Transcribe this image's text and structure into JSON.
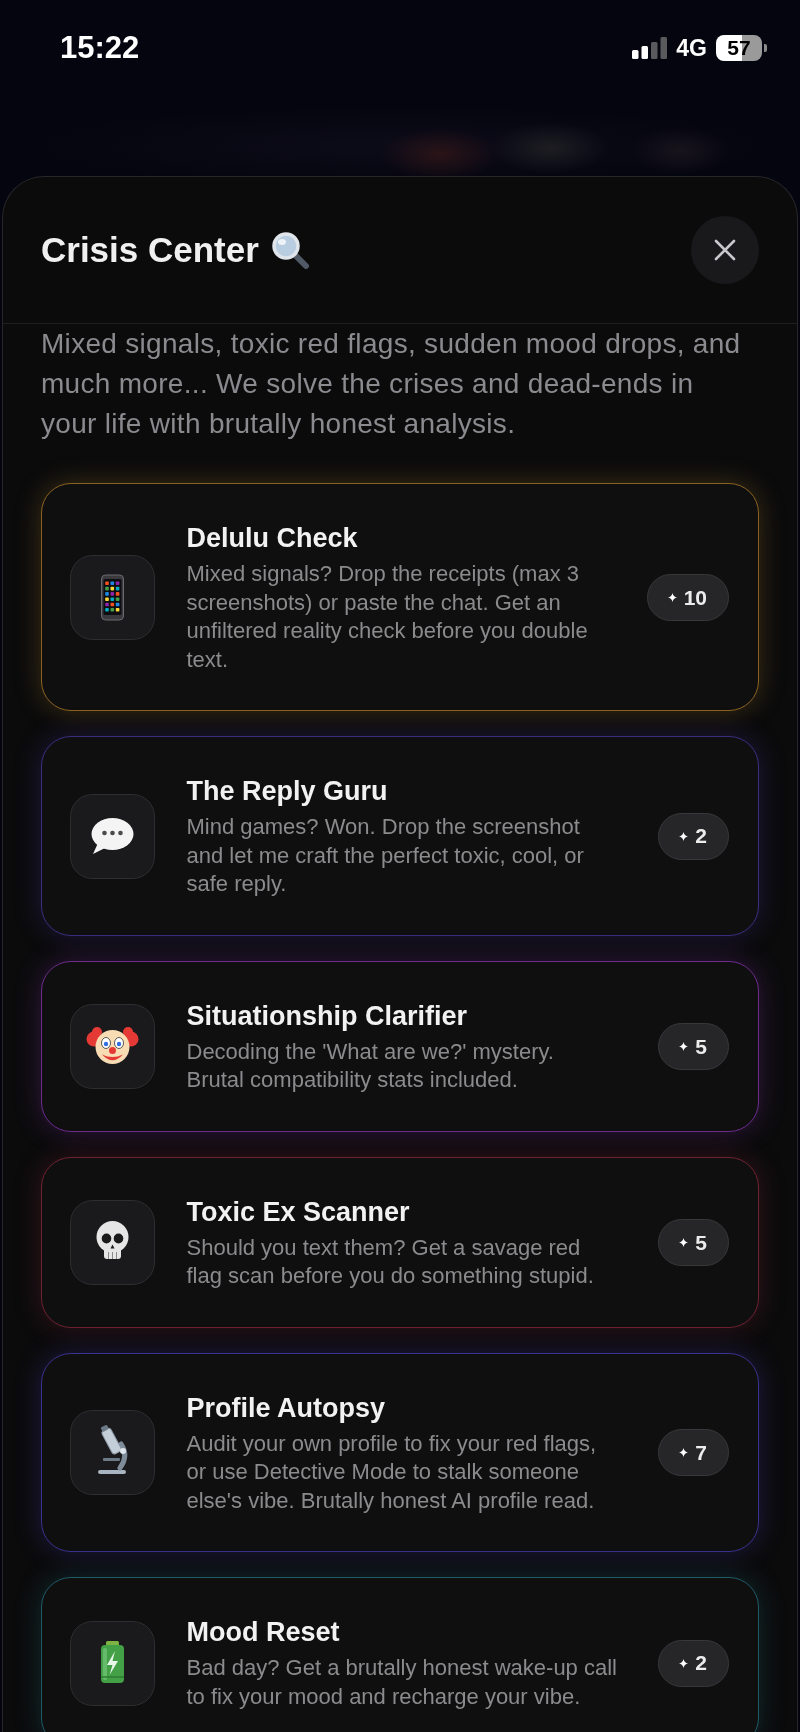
{
  "status_bar": {
    "time": "15:22",
    "network": "4G",
    "battery": "57"
  },
  "sheet": {
    "title": "Crisis Center",
    "description": "Mixed signals, toxic red flags, sudden mood drops, and much more... We solve the crises and dead-ends in your life with brutally honest analysis."
  },
  "tools": [
    {
      "title": "Delulu Check",
      "description": "Mixed signals? Drop the receipts (max 3 screenshots) or paste the chat. Get an unfiltered reality check before you double text.",
      "cost": "10",
      "color": "#8a6322"
    },
    {
      "title": "The Reply Guru",
      "description": "Mind games? Won. Drop the screenshot and let me craft the perfect toxic, cool, or safe reply.",
      "cost": "2",
      "color": "#3d2d80"
    },
    {
      "title": "Situationship Clarifier",
      "description": "Decoding the 'What are we?' mystery. Brutal compatibility stats included.",
      "cost": "5",
      "color": "#6b2c8c"
    },
    {
      "title": "Toxic Ex Scanner",
      "description": "Should you text them? Get a savage red flag scan before you do something stupid.",
      "cost": "5",
      "color": "#6e2231"
    },
    {
      "title": "Profile Autopsy",
      "description": "Audit your own profile to fix your red flags, or use Detective Mode to stalk someone else's vibe. Brutally honest AI profile read.",
      "cost": "7",
      "color": "#3b318f"
    },
    {
      "title": "Mood Reset",
      "description": "Bad day? Get a brutally honest wake-up call to fix your mood and recharge your vibe.",
      "cost": "2",
      "color": "#1d5b66"
    }
  ]
}
